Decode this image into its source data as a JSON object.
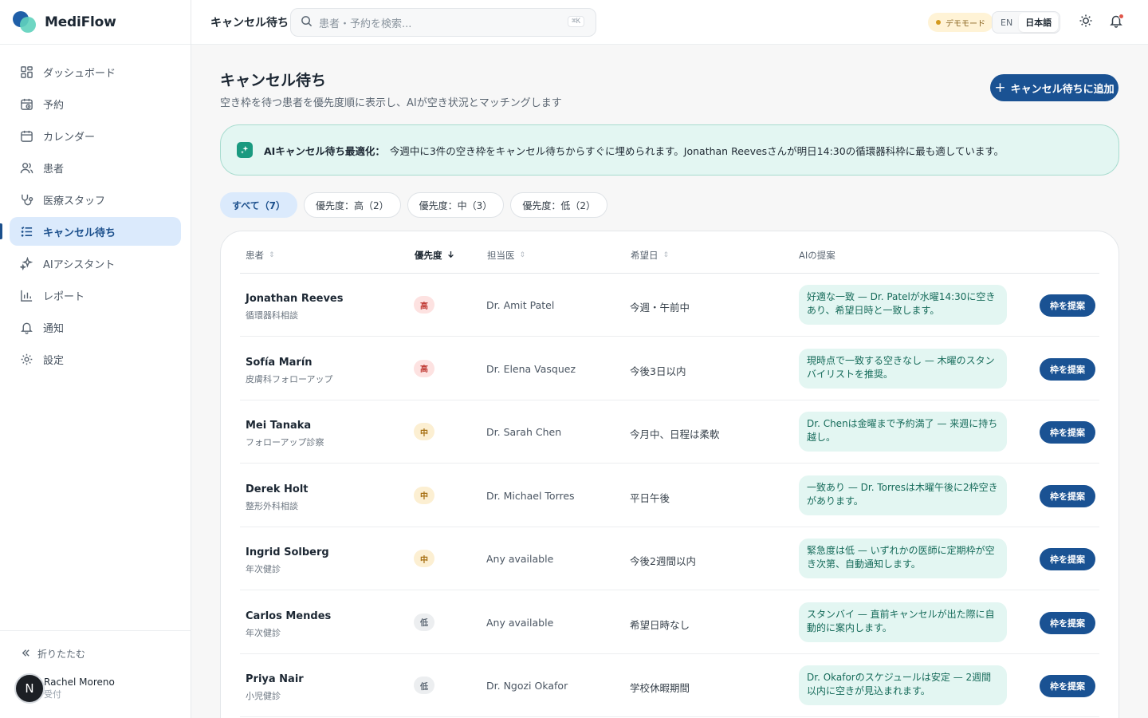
{
  "app": {
    "name": "MediFlow"
  },
  "sidebar": {
    "items": [
      {
        "label": "ダッシュボード",
        "icon": "dashboard-icon"
      },
      {
        "label": "予約",
        "icon": "calendar-clock-icon"
      },
      {
        "label": "カレンダー",
        "icon": "calendar-icon"
      },
      {
        "label": "患者",
        "icon": "users-icon"
      },
      {
        "label": "医療スタッフ",
        "icon": "stethoscope-icon"
      },
      {
        "label": "キャンセル待ち",
        "icon": "list-icon",
        "active": true
      },
      {
        "label": "AIアシスタント",
        "icon": "sparkles-icon"
      },
      {
        "label": "レポート",
        "icon": "bar-chart-icon"
      },
      {
        "label": "通知",
        "icon": "bell-icon"
      },
      {
        "label": "設定",
        "icon": "gear-icon"
      }
    ],
    "collapse_label": "折りたたむ",
    "user": {
      "initial": "N",
      "name": "Rachel Moreno",
      "role": "受付"
    }
  },
  "topbar": {
    "title": "キャンセル待ち",
    "search_placeholder": "患者・予約を検索...",
    "search_shortcut": "⌘K",
    "demo_label": "デモモード",
    "lang_en": "EN",
    "lang_ja": "日本語"
  },
  "page": {
    "title": "キャンセル待ち",
    "subtitle": "空き枠を待つ患者を優先度順に表示し、AIが空き状況とマッチングします",
    "add_button": "キャンセル待ちに追加"
  },
  "ai_banner": {
    "label": "AIキャンセル待ち最適化：",
    "text": "今週中に3件の空き枠をキャンセル待ちからすぐに埋められます。Jonathan Reevesさんが明日14:30の循環器科枠に最も適しています。"
  },
  "filters": [
    {
      "label": "すべて（7）",
      "active": true
    },
    {
      "label": "優先度：高（2）"
    },
    {
      "label": "優先度：中（3）"
    },
    {
      "label": "優先度：低（2）"
    }
  ],
  "table": {
    "headers": {
      "patient": "患者",
      "priority": "優先度",
      "doctor": "担当医",
      "preferred": "希望日",
      "ai": "AIの提案"
    },
    "action_label": "枠を提案",
    "rows": [
      {
        "name": "Jonathan Reeves",
        "type": "循環器科相談",
        "priority": "高",
        "level": "high",
        "doctor": "Dr. Amit Patel",
        "preferred": "今週・午前中",
        "suggestion": "好適な一致 — Dr. Patelが水曜14:30に空きあり、希望日時と一致します。"
      },
      {
        "name": "Sofía Marín",
        "type": "皮膚科フォローアップ",
        "priority": "高",
        "level": "high",
        "doctor": "Dr. Elena Vasquez",
        "preferred": "今後3日以内",
        "suggestion": "現時点で一致する空きなし — 木曜のスタンバイリストを推奨。"
      },
      {
        "name": "Mei Tanaka",
        "type": "フォローアップ診察",
        "priority": "中",
        "level": "mid",
        "doctor": "Dr. Sarah Chen",
        "preferred": "今月中、日程は柔軟",
        "suggestion": "Dr. Chenは金曜まで予約満了 — 来週に持ち越し。"
      },
      {
        "name": "Derek Holt",
        "type": "整形外科相談",
        "priority": "中",
        "level": "mid",
        "doctor": "Dr. Michael Torres",
        "preferred": "平日午後",
        "suggestion": "一致あり — Dr. Torresは木曜午後に2枠空きがあります。"
      },
      {
        "name": "Ingrid Solberg",
        "type": "年次健診",
        "priority": "中",
        "level": "mid",
        "doctor": "Any available",
        "preferred": "今後2週間以内",
        "suggestion": "緊急度は低 — いずれかの医師に定期枠が空き次第、自動通知します。"
      },
      {
        "name": "Carlos Mendes",
        "type": "年次健診",
        "priority": "低",
        "level": "low",
        "doctor": "Any available",
        "preferred": "希望日時なし",
        "suggestion": "スタンバイ — 直前キャンセルが出た際に自動的に案内します。"
      },
      {
        "name": "Priya Nair",
        "type": "小児健診",
        "priority": "低",
        "level": "low",
        "doctor": "Dr. Ngozi Okafor",
        "preferred": "学校休暇期間",
        "suggestion": "Dr. Okaforのスケジュールは安定 — 2週間以内に空きが見込まれます。"
      }
    ]
  },
  "colors": {
    "primary": "#1a5293",
    "active_nav_bg": "#dbeafc",
    "ai_banner_bg": "#e3f6f2",
    "high": "#c2403a",
    "mid": "#a66f12",
    "low": "#5c6773"
  }
}
